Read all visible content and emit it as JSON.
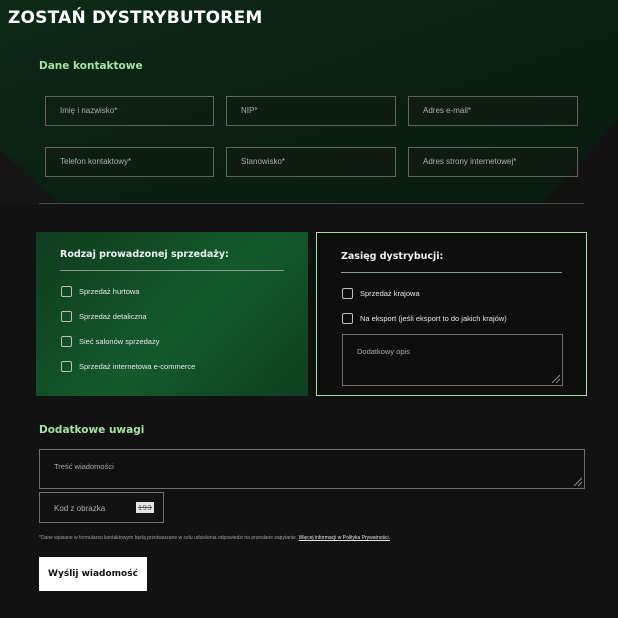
{
  "page_title": "ZOSTAŃ DYSTRYBUTOREM",
  "colors": {
    "accent": "#a8e2a3",
    "background": "#121212",
    "panel_green": "#135a2b"
  },
  "contact": {
    "heading": "Dane kontaktowe",
    "placeholders": {
      "name": "Imię i nazwisko*",
      "nip": "NIP*",
      "email": "Adres e-mail*",
      "phone": "Telefon kontaktowy*",
      "position": "Stanowisko*",
      "website": "Adres strony internetowej*"
    }
  },
  "sales_type": {
    "title": "Rodzaj prowadzonej sprzedaży:",
    "options": [
      "Sprzedaż hurtowa",
      "Sprzedaż detaliczna",
      "Sieć salonów sprzedaży",
      "Sprzedaż internetowa e-commerce"
    ]
  },
  "distribution": {
    "title": "Zasięg dystrybucji:",
    "options": [
      "Sprzedaż krajowa",
      "Na eksport (jeśli eksport to do jakich krajów)"
    ],
    "extra_placeholder": "Dodatkowy opis"
  },
  "remarks": {
    "heading": "Dodatkowe uwagi",
    "message_placeholder": "Treść wiadomości",
    "captcha_label": "Kod z obrazka",
    "captcha_code": "193"
  },
  "disclaimer": {
    "text": "*Dane wpisane w formularzu kontaktowym będą przetwarzane w celu udzielenia odpowiedzi na przesłane zapytanie.",
    "link": "Więcej informacji w Polityka Prywatności."
  },
  "submit_label": "Wyślij wiadomość"
}
